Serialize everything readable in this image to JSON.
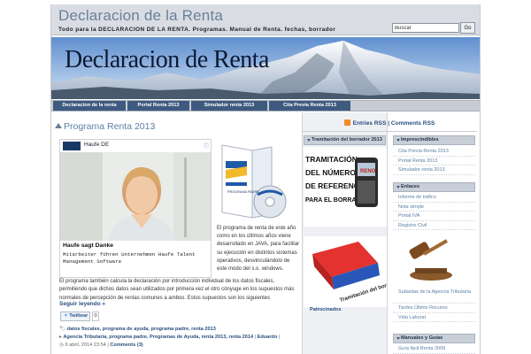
{
  "site": {
    "title": "Declaracion de la Renta",
    "tagline": "Todo para la DECLARACION DE LA RENTA. Programas. Manual de Renta. fechas, borrador",
    "banner_text": "Declaracion de Renta"
  },
  "search": {
    "value": "Buscar",
    "button": "Go"
  },
  "nav": {
    "items": [
      {
        "label": "Declaracion de la renta"
      },
      {
        "label": "Portal Renta 2013"
      },
      {
        "label": "Simulador renta 2013"
      },
      {
        "label": "Cita Previa Renta 2013"
      }
    ]
  },
  "post": {
    "title": "Programa Renta 2013",
    "ad": {
      "brand": "Haufe DE",
      "close": "ⓘ",
      "caption": "Haufe sagt Danke",
      "subtext": "Mitarbeiter führen Unternehmen Haufe Talent Management Software"
    },
    "product_box_label": "PROGRAMA PADRE",
    "side_text": "El programa de renta de este año como en los últimos años viene desarrollado en JAVA, para facilitar su ejecución en distintos sistemas operativos, desvinculándolo de este modo del s.o. windows.",
    "body_text": "El programa también calcula la declaración por introducción individual de los datos fiscales, permitiendo que dichos datos sean utilizados por primera vez el otro cónyuge en los supuestos más normales de percepción de rentas comunes a ambos. Estos supuestos son los siguientes",
    "read_more": "Seguir leyendo »",
    "tweet_label": "Twittear",
    "tweet_count": "0",
    "tags_label": "datos fiscales, programa de ayuda, programa padre, renta 2013",
    "categories": "Agencia Tributaria, programa padre, Programas de Ayuda, renta 2013, renta 2014",
    "author": "Eduardo",
    "date": "9 abril, 2014 23:54",
    "comments": "Comments (3)"
  },
  "rss": {
    "entries": "Entries RSS",
    "comments": "Comments RSS",
    "separator": "|"
  },
  "middle_widget": {
    "title": "Tramitación del borrador 2013",
    "image1_text": [
      "TRAMITACIÓN",
      "DEL NÚMERO",
      "DE REFERENCIA",
      "PARA EL BORRADOR"
    ],
    "phone_label": "RENO",
    "eraser_text": "Tramitación del borrador",
    "sponsored": "Patrocinados"
  },
  "right_widgets": {
    "imprescindibles": {
      "title": "Imprescindibles",
      "items": [
        "Cita Previa Renta 2013",
        "Portal Renta 2013",
        "Simulador renta 2013"
      ]
    },
    "enlaces": {
      "title": "Enlaces",
      "items": [
        "Informe de tráfico",
        "Nota simple",
        "Portal IVA",
        "Registro Civil",
        "Subastas de la Agencia Tributaria",
        "Tardes Último Recurso",
        "Vida Laboral"
      ]
    },
    "manuales": {
      "title": "Manuales y Guías",
      "items": [
        "Guía fácil Renta 2009"
      ]
    }
  },
  "colors": {
    "nav_bg": "#3f5a7f",
    "title_blue": "#6a7f99",
    "link_blue": "#2a4f80"
  }
}
